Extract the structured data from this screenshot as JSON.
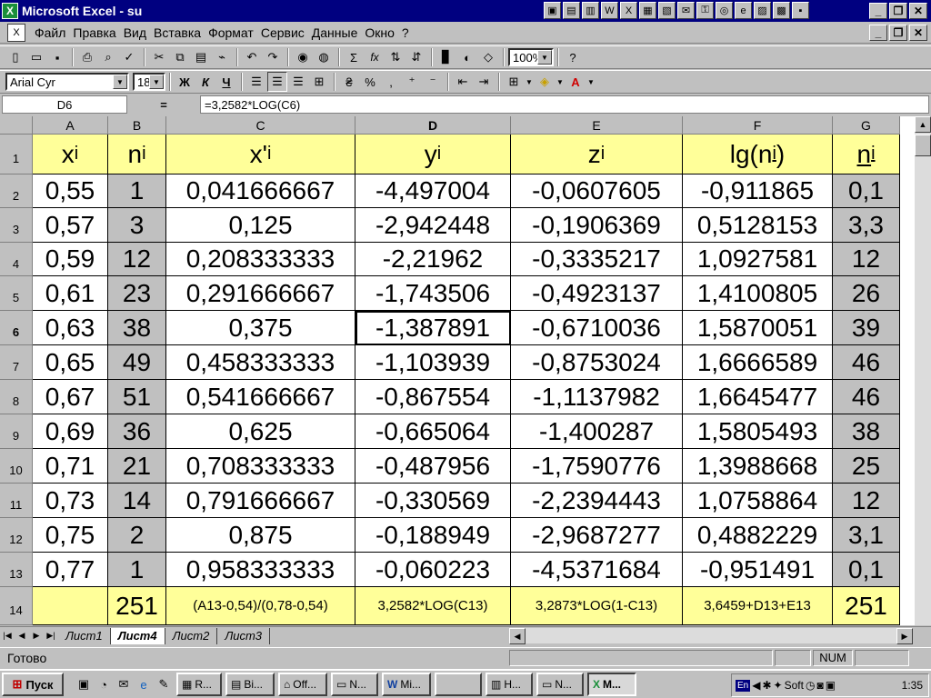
{
  "window": {
    "title": "Microsoft Excel - su",
    "app_icon": "X",
    "controls": [
      "_",
      "❐",
      "✕"
    ]
  },
  "menu": {
    "items": [
      "Файл",
      "Правка",
      "Вид",
      "Вставка",
      "Формат",
      "Сервис",
      "Данные",
      "Окно",
      "?"
    ]
  },
  "toolbar": {
    "zoom": "100%",
    "font_name": "Arial Cyr",
    "font_size": "18",
    "bold": "Ж",
    "italic": "К",
    "underline": "Ч",
    "percent": "%",
    "sum": "Σ",
    "fx": "fx"
  },
  "formula_bar": {
    "name_box": "D6",
    "equals": "=",
    "formula": "=3,2582*LOG(C6)"
  },
  "sheet": {
    "columns": [
      "A",
      "B",
      "C",
      "D",
      "E",
      "F",
      "G"
    ],
    "rows": [
      "1",
      "2",
      "3",
      "4",
      "5",
      "6",
      "7",
      "8",
      "9",
      "10",
      "11",
      "12",
      "13",
      "14"
    ],
    "headers": {
      "A": {
        "base": "x",
        "sub": "i"
      },
      "B": {
        "base": "n",
        "sub": "i"
      },
      "C": {
        "base": "x'",
        "sub": "i"
      },
      "D": {
        "base": "y",
        "sub": "i"
      },
      "E": {
        "base": "z",
        "sub": "i"
      },
      "F": {
        "base": "lg(n",
        "sub": "i",
        "tail": ")"
      },
      "G": {
        "base": "n",
        "sub": "i"
      }
    },
    "data": [
      [
        "0,55",
        "1",
        "0,041666667",
        "-4,497004",
        "-0,0607605",
        "-0,911865",
        "0,1"
      ],
      [
        "0,57",
        "3",
        "0,125",
        "-2,942448",
        "-0,1906369",
        "0,5128153",
        "3,3"
      ],
      [
        "0,59",
        "12",
        "0,208333333",
        "-2,21962",
        "-0,3335217",
        "1,0927581",
        "12"
      ],
      [
        "0,61",
        "23",
        "0,291666667",
        "-1,743506",
        "-0,4923137",
        "1,4100805",
        "26"
      ],
      [
        "0,63",
        "38",
        "0,375",
        "-1,387891",
        "-0,6710036",
        "1,5870051",
        "39"
      ],
      [
        "0,65",
        "49",
        "0,458333333",
        "-1,103939",
        "-0,8753024",
        "1,6666589",
        "46"
      ],
      [
        "0,67",
        "51",
        "0,541666667",
        "-0,867554",
        "-1,1137982",
        "1,6645477",
        "46"
      ],
      [
        "0,69",
        "36",
        "0,625",
        "-0,665064",
        "-1,400287",
        "1,5805493",
        "38"
      ],
      [
        "0,71",
        "21",
        "0,708333333",
        "-0,487956",
        "-1,7590776",
        "1,3988668",
        "25"
      ],
      [
        "0,73",
        "14",
        "0,791666667",
        "-0,330569",
        "-2,2394443",
        "1,0758864",
        "12"
      ],
      [
        "0,75",
        "2",
        "0,875",
        "-0,188949",
        "-2,9687277",
        "0,4882229",
        "3,1"
      ],
      [
        "0,77",
        "1",
        "0,958333333",
        "-0,060223",
        "-4,5371684",
        "-0,951491",
        "0,1"
      ]
    ],
    "footer": [
      "",
      "251",
      "(A13-0,54)/(0,78-0,54)",
      "3,2582*LOG(C13)",
      "3,2873*LOG(1-C13)",
      "3,6459+D13+E13",
      "251"
    ],
    "active_cell": "D6"
  },
  "tabs": {
    "sheets": [
      "Лист1",
      "Лист4",
      "Лист2",
      "Лист3"
    ],
    "active": "Лист4"
  },
  "status": {
    "text": "Готово",
    "num": "NUM"
  },
  "taskbar": {
    "start": "Пуск",
    "tasks": [
      "R...",
      "Bi...",
      "Off...",
      "N...",
      "Mi...",
      "",
      "H...",
      "N...",
      "M..."
    ],
    "active_task": "M...",
    "lang": "En",
    "soft": "Soft",
    "clock": "1:35"
  },
  "colors": {
    "title_bg": "#000080",
    "header_fill": "#ffff99",
    "gray_fill": "#c0c0c0"
  }
}
